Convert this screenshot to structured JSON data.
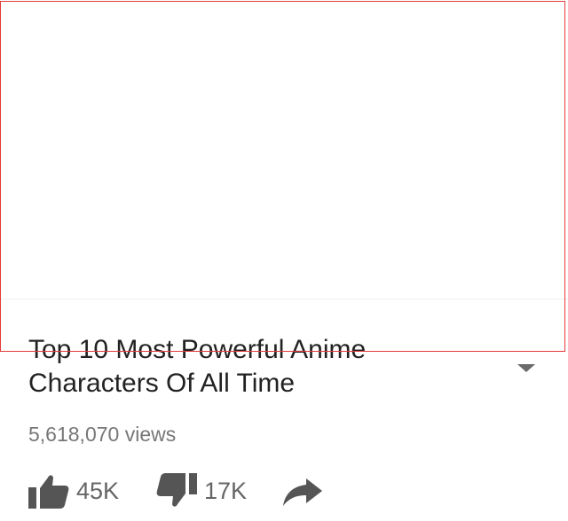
{
  "video": {
    "title_line1": "Top 10 Most Powerful Anime",
    "title_line2": "Characters Of All Time",
    "views": "5,618,070 views"
  },
  "actions": {
    "likes": "45K",
    "dislikes": "17K"
  },
  "icons": {
    "expand": "chevron-down-icon",
    "like": "thumbs-up-icon",
    "dislike": "thumbs-down-icon",
    "share": "share-arrow-icon"
  },
  "colors": {
    "highlight_frame": "#e53b3b",
    "icon": "#555555"
  }
}
